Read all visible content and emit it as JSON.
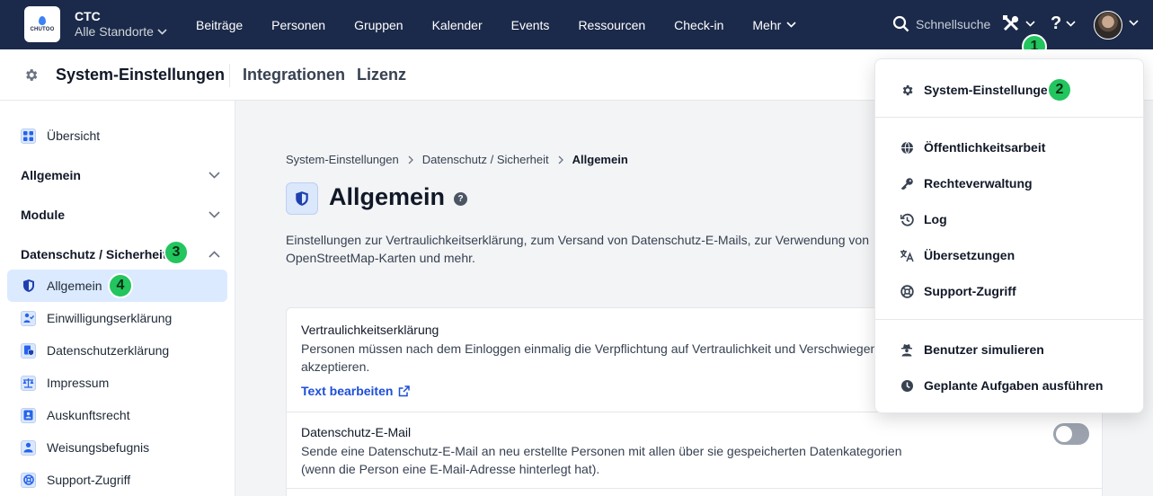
{
  "org": {
    "logo_text": "CHUTOO",
    "name": "CTC",
    "location": "Alle Standorte"
  },
  "nav": {
    "items": [
      "Beiträge",
      "Personen",
      "Gruppen",
      "Kalender",
      "Events",
      "Ressourcen",
      "Check-in",
      "Mehr"
    ],
    "search_placeholder": "Schnellsuche",
    "help_glyph": "?"
  },
  "subheader": {
    "settings": "System-Einstellungen",
    "integrations": "Integrationen",
    "license": "Lizenz"
  },
  "sidebar": {
    "overview": "Übersicht",
    "sections": [
      "Allgemein",
      "Module",
      "Datenschutz / Sicherheit"
    ],
    "items": [
      "Allgemein",
      "Einwilligungserklärung",
      "Datenschutzerklärung",
      "Impressum",
      "Auskunftsrecht",
      "Weisungsbefugnis",
      "Support-Zugriff"
    ]
  },
  "main": {
    "breadcrumb": [
      "System-Einstellungen",
      "Datenschutz / Sicherheit",
      "Allgemein"
    ],
    "title": "Allgemein",
    "help_glyph": "?",
    "description": "Einstellungen zur Vertraulichkeitserklärung, zum Versand von Datenschutz-E-Mails, zur Verwendung von OpenStreetMap-Karten und mehr.",
    "rows": [
      {
        "title": "Vertraulichkeitserklärung",
        "desc": "Personen müssen nach dem Einloggen einmalig die Verpflichtung auf Vertraulichkeit und Verschwiegenheit akzeptieren.",
        "link": "Text bearbeiten"
      },
      {
        "title": "Datenschutz-E-Mail",
        "desc": "Sende eine Datenschutz-E-Mail an neu erstellte Personen mit allen über sie gespeicherten Datenkategorien (wenn die Person eine E-Mail-Adresse hinterlegt hat).",
        "enabled": false
      }
    ]
  },
  "dropdown": {
    "items": [
      "System-Einstellungen",
      "Öffentlichkeitsarbeit",
      "Rechteverwaltung",
      "Log",
      "Übersetzungen",
      "Support-Zugriff",
      "Benutzer simulieren",
      "Geplante Aufgaben ausführen"
    ]
  },
  "badges": [
    "1",
    "2",
    "3",
    "4"
  ],
  "colors": {
    "nav_bg": "#1b2a4a",
    "accent": "#1d4ed8",
    "badge": "#22c55e",
    "active_bg": "#dbeafe"
  }
}
